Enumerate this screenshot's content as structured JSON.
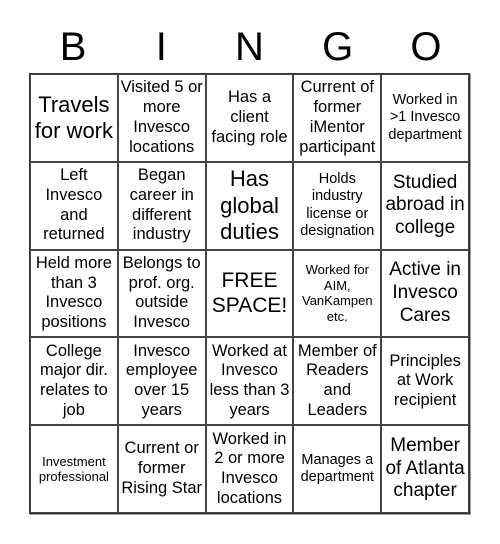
{
  "header": {
    "letters": [
      "B",
      "I",
      "N",
      "G",
      "O"
    ]
  },
  "cells": [
    [
      "Travels for work",
      "Visited 5 or more Invesco locations",
      "Has a client facing role",
      "Current of former iMentor participant",
      "Worked in >1 Invesco department"
    ],
    [
      "Left Invesco and returned",
      "Began career in different industry",
      "Has global duties",
      "Holds industry license or designation",
      "Studied abroad in college"
    ],
    [
      "Held more than 3 Invesco positions",
      "Belongs to prof. org. outside Invesco",
      "FREE SPACE!",
      "Worked for AIM, VanKampen etc.",
      "Active in Invesco Cares"
    ],
    [
      "College major dir. relates to job",
      "Invesco employee over 15 years",
      "Worked at Invesco less than 3 years",
      "Member of Readers and Leaders",
      "Principles at Work recipient"
    ],
    [
      "Investment professional",
      "Current or former Rising Star",
      "Worked in 2 or more Invesco locations",
      "Manages a department",
      "Member of Atlanta chapter"
    ]
  ]
}
